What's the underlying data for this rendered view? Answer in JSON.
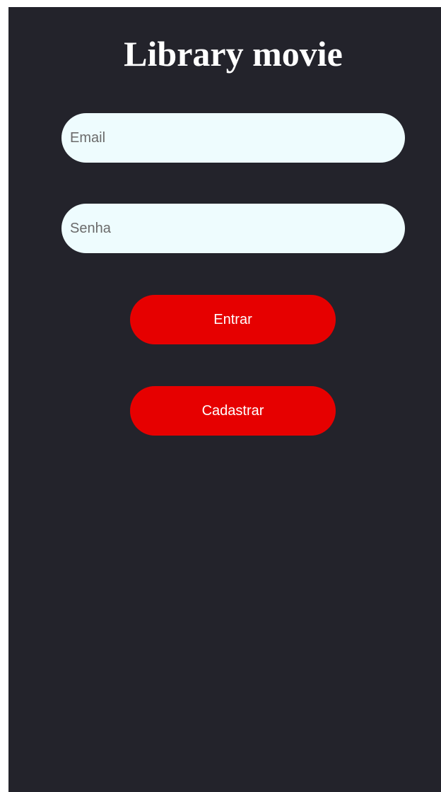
{
  "app": {
    "title": "Library movie"
  },
  "form": {
    "email_placeholder": "Email",
    "password_placeholder": "Senha",
    "login_label": "Entrar",
    "register_label": "Cadastrar"
  },
  "colors": {
    "background": "#23232b",
    "input_background": "#eefcfe",
    "button_background": "#e60000",
    "title_text": "#ffffff"
  }
}
